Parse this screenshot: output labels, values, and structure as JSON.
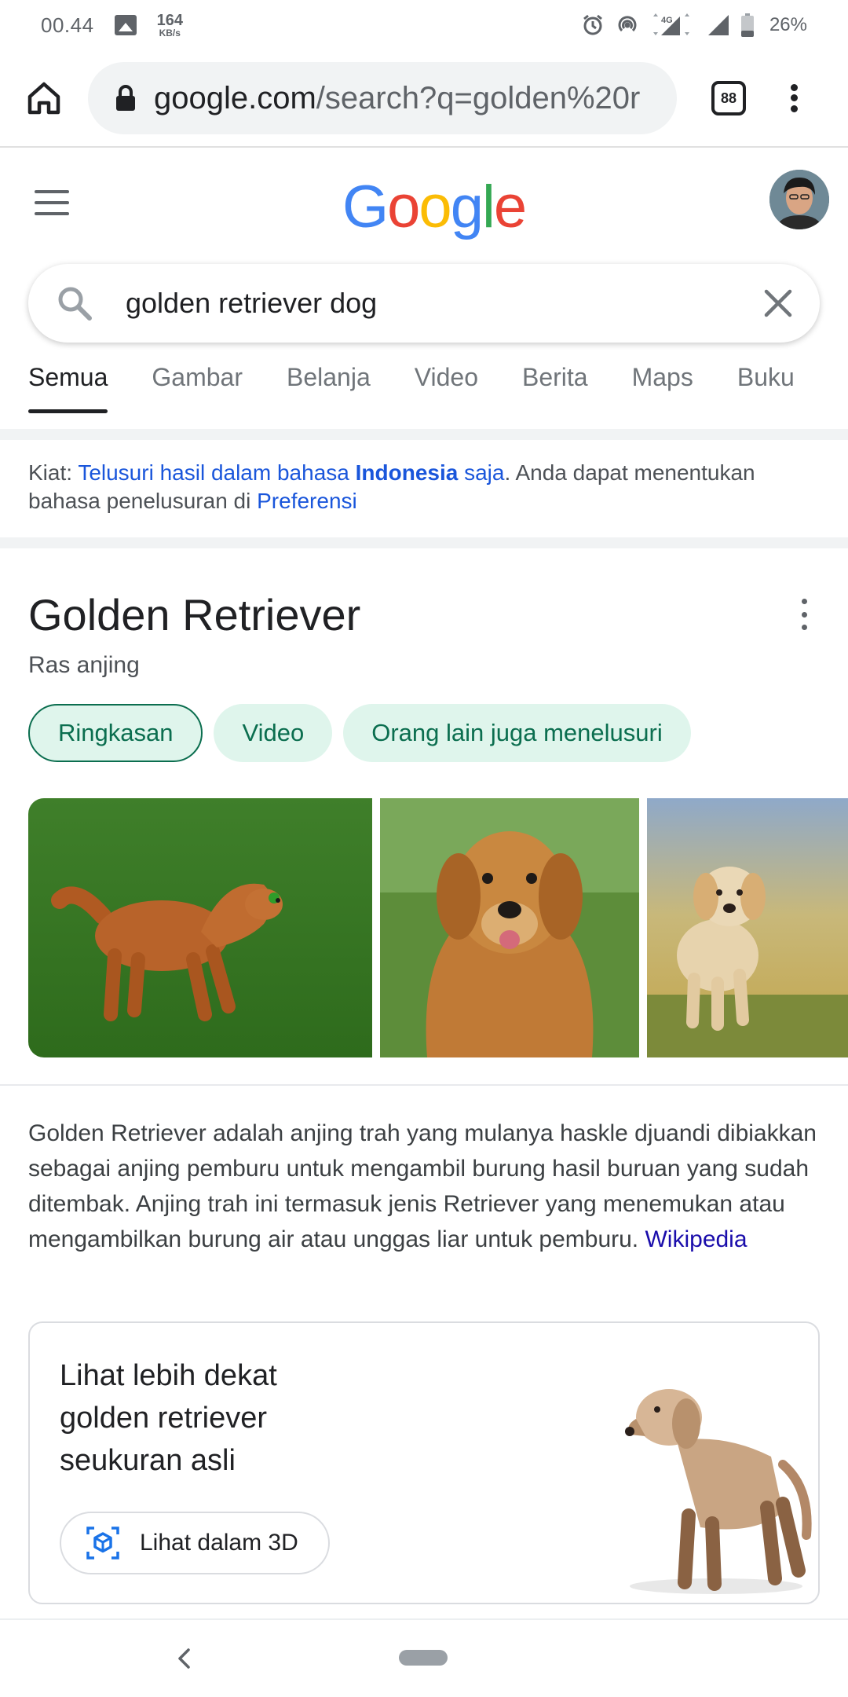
{
  "status": {
    "time": "00.44",
    "kbs_value": "164",
    "kbs_unit": "KB/s",
    "network": "4G",
    "battery": "26%"
  },
  "browser": {
    "url_domain": "google.com",
    "url_rest": "/search?q=golden%20r",
    "tab_count": "88"
  },
  "google": {
    "logo": [
      "G",
      "o",
      "o",
      "g",
      "l",
      "e"
    ],
    "logo_colors": [
      "#4285F4",
      "#EA4335",
      "#FBBC05",
      "#4285F4",
      "#34A853",
      "#EA4335"
    ]
  },
  "search": {
    "query": "golden retriever dog"
  },
  "tabs": [
    {
      "label": "Semua",
      "active": true
    },
    {
      "label": "Gambar"
    },
    {
      "label": "Belanja"
    },
    {
      "label": "Video"
    },
    {
      "label": "Berita"
    },
    {
      "label": "Maps"
    },
    {
      "label": "Buku"
    }
  ],
  "tip": {
    "prefix": "Kiat: ",
    "link1_a": "Telusuri hasil dalam bahasa ",
    "link1_b": "Indonesia",
    "link1_c": " saja",
    "middle": ". Anda dapat menentukan bahasa penelusuran di ",
    "link2": "Preferensi"
  },
  "knowledge_panel": {
    "title": "Golden Retriever",
    "subtitle": "Ras anjing",
    "chips": [
      "Ringkasan",
      "Video",
      "Orang lain juga menelusuri"
    ],
    "description": "Golden Retriever adalah anjing trah yang mulanya haskle djuandi dibiakkan sebagai anjing pemburu untuk mengambil burung hasil buruan yang sudah ditembak. Anjing trah ini termasuk jenis Retriever yang menemukan atau mengambilkan burung air atau unggas liar untuk pemburu. ",
    "source": "Wikipedia"
  },
  "card_3d": {
    "title": "Lihat lebih dekat golden retriever seukuran asli",
    "button": "Lihat dalam 3D"
  },
  "colors": {
    "chip_bg": "#dff5ec",
    "chip_text": "#0b6e4f",
    "link": "#1a0dab",
    "accent_blue": "#1a73e8"
  }
}
